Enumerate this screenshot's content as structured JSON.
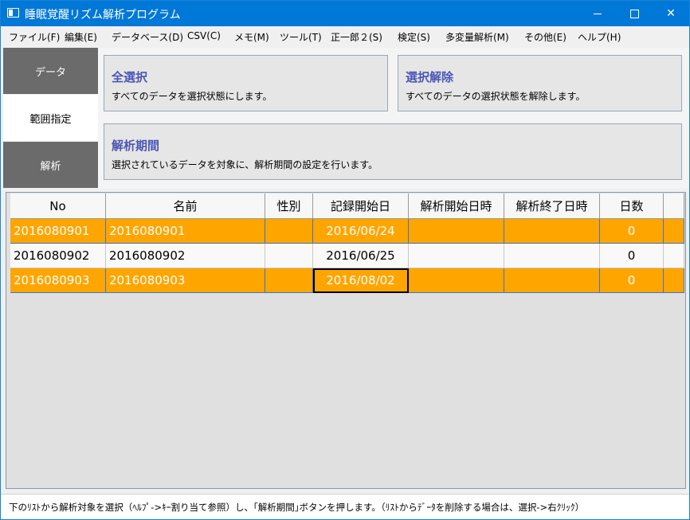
{
  "window": {
    "title": "睡眠覚醒リズム解析プログラム",
    "controls": {
      "minimize": "—",
      "maximize": "□",
      "close": "✕"
    }
  },
  "menu": [
    "ファイル(F)",
    "編集(E)",
    "データベース(D)",
    "CSV(C)",
    "メモ(M)",
    "ツール(T)",
    "正一郎２(S)",
    "検定(S)",
    "多変量解析(M)",
    "その他(E)",
    "ヘルプ(H)"
  ],
  "sidebar": {
    "tabs": [
      {
        "label": "データ",
        "active": false
      },
      {
        "label": "範囲指定",
        "active": true
      },
      {
        "label": "解析",
        "active": false
      }
    ]
  },
  "actions": {
    "select_all": {
      "title": "全選択",
      "desc": "すべてのデータを選択状態にします。"
    },
    "deselect_all": {
      "title": "選択解除",
      "desc": "すべてのデータの選択状態を解除します。"
    },
    "analysis_period": {
      "title": "解析期間",
      "desc": "選択されているデータを対象に、解析期間の設定を行います。"
    }
  },
  "grid": {
    "columns": [
      "No",
      "名前",
      "性別",
      "記録開始日",
      "解析開始日時",
      "解析終了日時",
      "日数"
    ],
    "rows": [
      {
        "no": "2016080901",
        "name": "2016080901",
        "sex": "",
        "record_start": "2016/06/24",
        "analysis_start": "",
        "analysis_end": "",
        "days": "0",
        "selected": true
      },
      {
        "no": "2016080902",
        "name": "2016080902",
        "sex": "",
        "record_start": "2016/06/25",
        "analysis_start": "",
        "analysis_end": "",
        "days": "0",
        "selected": false
      },
      {
        "no": "2016080903",
        "name": "2016080903",
        "sex": "",
        "record_start": "2016/08/02",
        "analysis_start": "",
        "analysis_end": "",
        "days": "0",
        "selected": true
      }
    ],
    "selection_color": "#ffa500"
  },
  "status": {
    "text": "下のﾘｽﾄから解析対象を選択（ﾍﾙﾌﾟ->ｷｰ割り当て参照）し、｢解析期間｣ボタンを押します。（ﾘｽﾄからﾃﾞｰﾀを削除する場合は、選択->右ｸﾘｯｸ）"
  },
  "colors": {
    "titlebar": "#0078d7",
    "accent_text": "#4a56b5",
    "tab_dark": "#6b6b6b"
  }
}
